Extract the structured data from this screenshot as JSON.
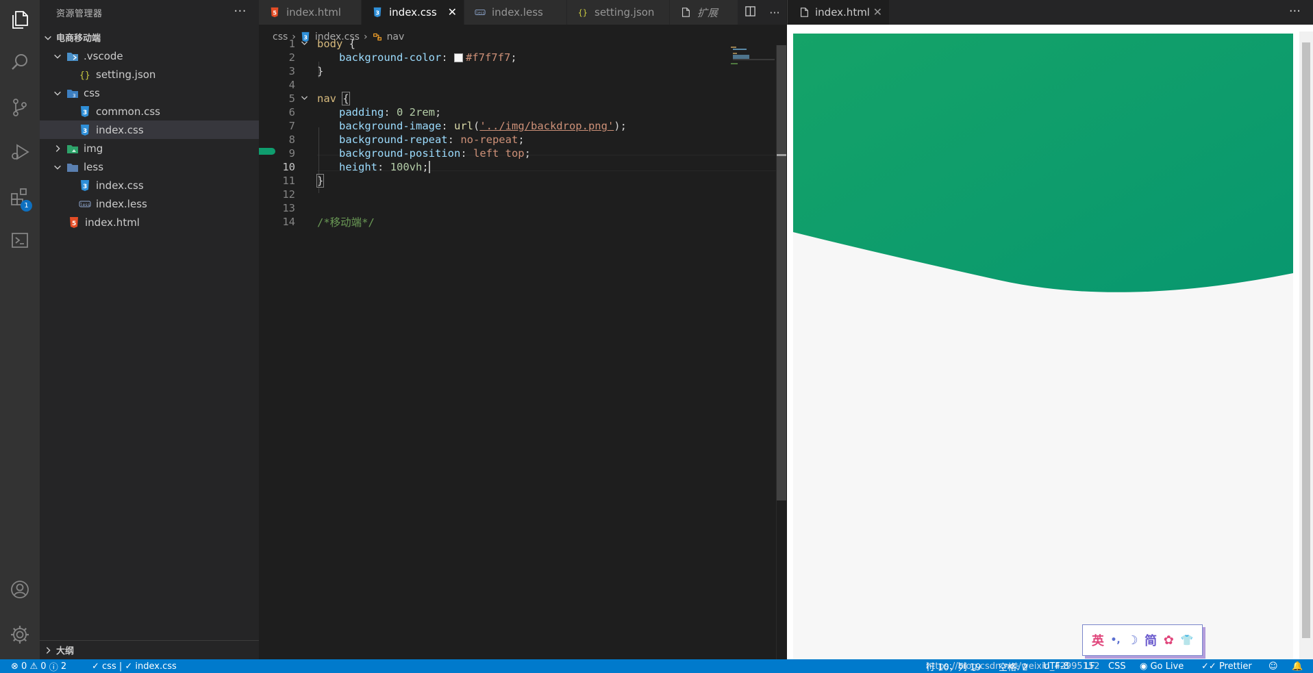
{
  "sidebar": {
    "title": "资源管理器",
    "more": "···",
    "root": "电商移动端",
    "items": [
      {
        "label": ".vscode"
      },
      {
        "label": "setting.json"
      },
      {
        "label": "css"
      },
      {
        "label": "common.css"
      },
      {
        "label": "index.css"
      },
      {
        "label": "img"
      },
      {
        "label": "less"
      },
      {
        "label": "index.css"
      },
      {
        "label": "index.less"
      },
      {
        "label": "index.html"
      }
    ],
    "outline": "大纲"
  },
  "activity": {
    "extensions_badge": "1",
    "icons": [
      "explorer-icon",
      "search-icon",
      "source-control-icon",
      "run-debug-icon",
      "extensions-icon",
      "remote-icon",
      "account-icon",
      "settings-gear-icon"
    ]
  },
  "tabs": [
    {
      "label": "index.html"
    },
    {
      "label": "index.css"
    },
    {
      "label": "index.less"
    },
    {
      "label": "setting.json"
    },
    {
      "label": "扩展"
    }
  ],
  "tab_close": "✕",
  "tab_more": "···",
  "breadcrumb": {
    "folder": "css",
    "file": "index.css",
    "symbol": "nav"
  },
  "editor": {
    "line_numbers": [
      "1",
      "2",
      "3",
      "4",
      "5",
      "6",
      "7",
      "8",
      "9",
      "10",
      "11",
      "12",
      "13",
      "14"
    ],
    "code": {
      "l1_sel": "body",
      "l1_brace": " {",
      "l2_prop": "background-color",
      "l2_colon": ": ",
      "l2_val": "#f7f7f7",
      "l2_end": ";",
      "l3_brace": "}",
      "l5_sel": "nav",
      "l5_space": " ",
      "l5_brace": "{",
      "l6_prop": "padding",
      "l6_colon": ": ",
      "l6_val": "0 2rem",
      "l6_end": ";",
      "l7_prop": "background-image",
      "l7_colon": ": ",
      "l7_fn": "url",
      "l7_open": "(",
      "l7_str": "'../img/backdrop.png'",
      "l7_close": ");",
      "l8_prop": "background-repeat",
      "l8_colon": ": ",
      "l8_val": "no-repeat",
      "l8_end": ";",
      "l9_prop": "background-position",
      "l9_colon": ": ",
      "l9_val": "left top",
      "l9_end": ";",
      "l10_prop": "height",
      "l10_colon": ": ",
      "l10_val": "100vh",
      "l10_end": ";",
      "l11_brace": "}",
      "l14_cmt": "/*移动端*/"
    }
  },
  "preview": {
    "tab": "index.html",
    "close": "✕",
    "more": "···",
    "ime": [
      "英",
      "•,",
      "☽",
      "简",
      "✿",
      "👕"
    ]
  },
  "statusbar": {
    "errors": "0",
    "warnings": "0",
    "infos": "2",
    "check": "✓ css | ✓ index.css",
    "position": "行 10，列 19",
    "spaces": "空格: 2",
    "encoding": "UTF-8",
    "eol": "LF",
    "language": "CSS",
    "golive": "Go Live",
    "prettier": "Prettier",
    "watermark": "https://blog.csdn.net/weixin_42995152"
  },
  "colors": {
    "accent": "#007acc",
    "green_banner": "#11a06a",
    "page_bg": "#f7f7f7"
  }
}
